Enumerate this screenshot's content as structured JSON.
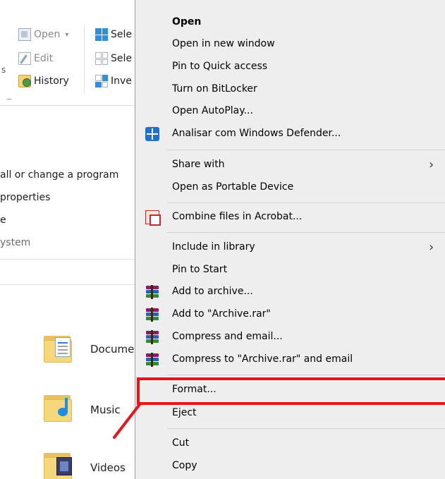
{
  "ribbon": {
    "open_label": "Open",
    "open_caret": "▾",
    "edit_label": "Edit",
    "history_label": "History",
    "select_all_label": "Sele",
    "select_none_label": "Sele",
    "invert_label": "Inve",
    "left_stub": "s"
  },
  "commands": {
    "uninstall": "all or change a program",
    "properties": "properties",
    "item3": "e",
    "group_system": "ystem"
  },
  "folders": [
    {
      "label": "Docume",
      "icon": "documents-folder-icon"
    },
    {
      "label": "Music",
      "icon": "music-folder-icon"
    },
    {
      "label": "Videos",
      "icon": "videos-folder-icon"
    }
  ],
  "context_menu": {
    "items": [
      {
        "label": "Open",
        "bold": true
      },
      {
        "label": "Open in new window"
      },
      {
        "label": "Pin to Quick access"
      },
      {
        "label": "Turn on BitLocker"
      },
      {
        "label": "Open AutoPlay..."
      },
      {
        "label": "Analisar com Windows Defender...",
        "icon": "windows-defender-icon"
      },
      {
        "label": "Share with",
        "submenu": true
      },
      {
        "label": "Open as Portable Device"
      },
      {
        "label": "Combine files in Acrobat...",
        "icon": "acrobat-icon"
      },
      {
        "label": "Include in library",
        "submenu": true
      },
      {
        "label": "Pin to Start"
      },
      {
        "label": "Add to archive...",
        "icon": "winrar-icon"
      },
      {
        "label": "Add to \"Archive.rar\"",
        "icon": "winrar-icon"
      },
      {
        "label": "Compress and email...",
        "icon": "winrar-icon"
      },
      {
        "label": "Compress to \"Archive.rar\" and email",
        "icon": "winrar-icon"
      },
      {
        "label": "Format..."
      },
      {
        "label": "Eject"
      },
      {
        "label": "Cut"
      },
      {
        "label": "Copy"
      }
    ],
    "submenu_arrow": "›"
  },
  "annotation": {
    "highlight_color": "#e8141c",
    "highlighted_item": "Format..."
  }
}
